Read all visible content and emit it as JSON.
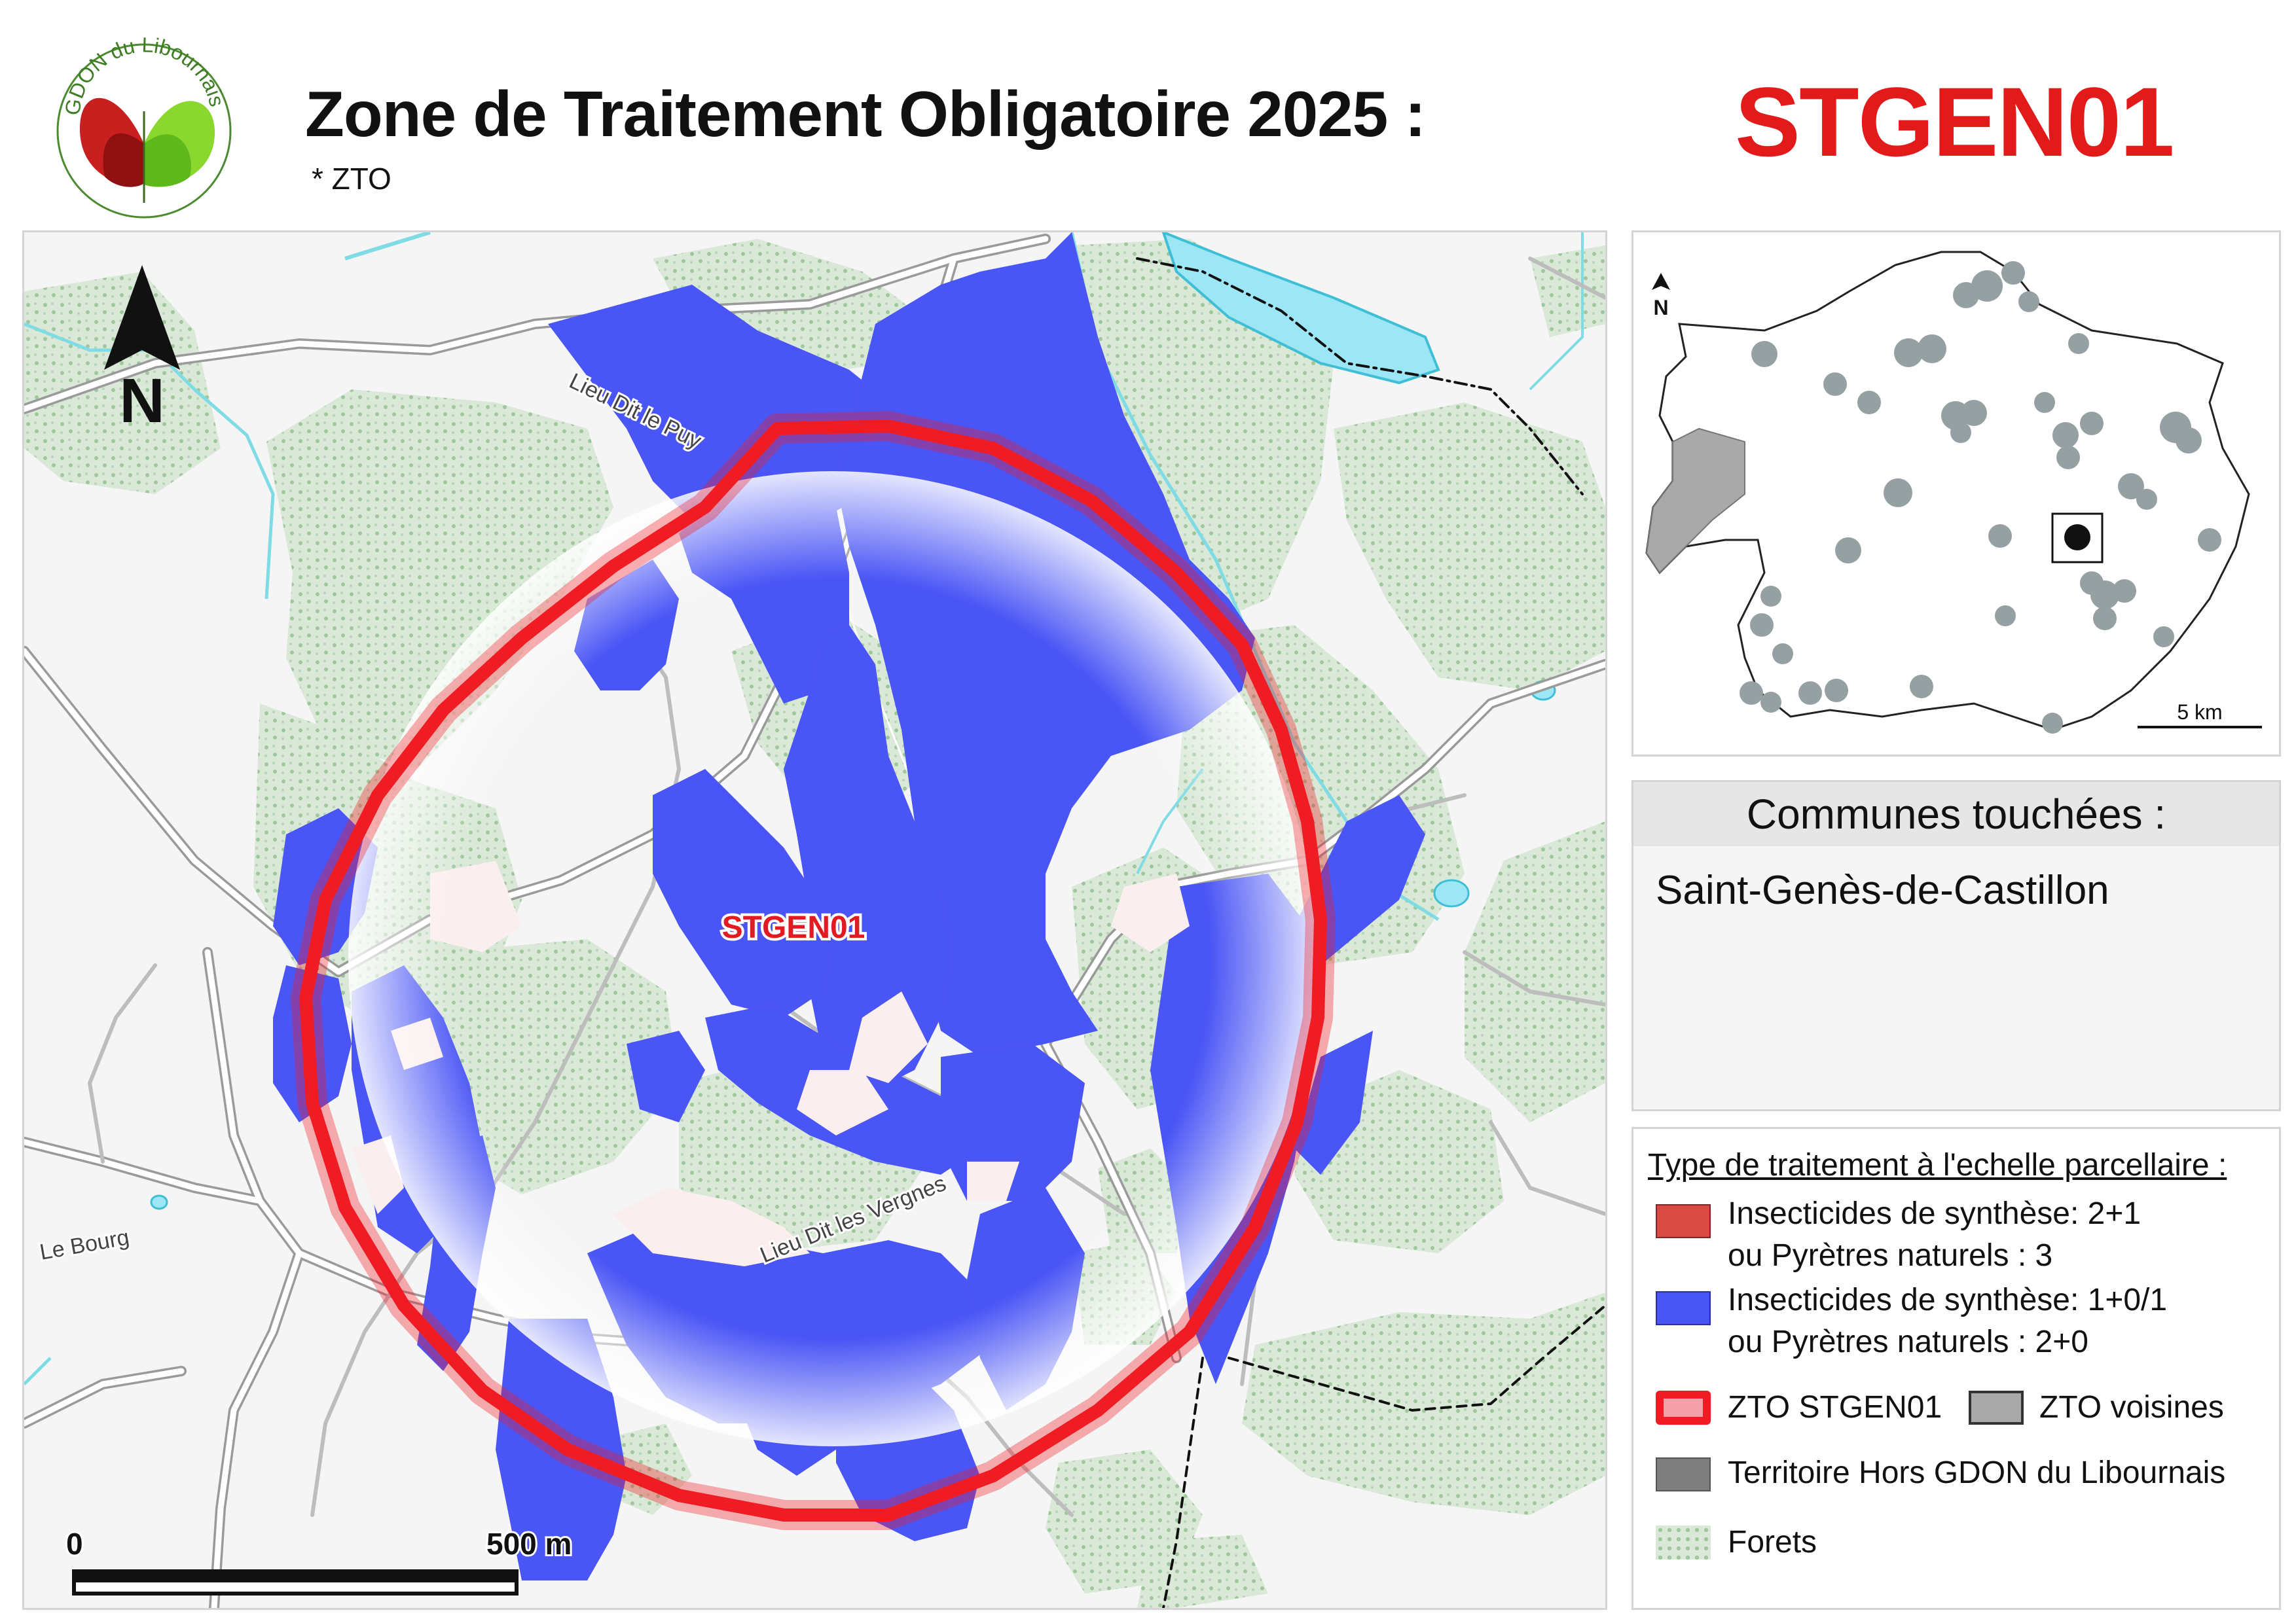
{
  "header": {
    "title": "Zone de Traitement Obligatoire 2025 :",
    "subtitle": "* ZTO",
    "zone_code": "STGEN01",
    "logo_text": "GDON du Libournais"
  },
  "main_map": {
    "zone_label": "STGEN01",
    "places": {
      "lieu_dit_puy": "Lieu Dit le Puy",
      "lieu_dit_vergnes": "Lieu Dit les Vergnes",
      "le_bourg": "Le Bourg"
    },
    "north_letter": "N",
    "scale": {
      "start": "0",
      "end": "500 m"
    }
  },
  "inset_map": {
    "north_letter": "N",
    "scale_label": "5 km"
  },
  "communes": {
    "heading": "Communes touchées :",
    "items": [
      "Saint-Genès-de-Castillon"
    ]
  },
  "legend": {
    "title": "Type de traitement à l'echelle parcellaire :",
    "red_line1": "Insecticides de synthèse: 2+1",
    "red_line2": "ou Pyrètres naturels : 3",
    "blue_line1": "Insecticides de synthèse: 1+0/1",
    "blue_line2": "ou Pyrètres naturels : 2+0",
    "zto_self": "ZTO STGEN01",
    "zto_neighbors": "ZTO voisines",
    "outside": "Territoire Hors GDON du Libournais",
    "forest": "Forets"
  },
  "colors": {
    "treatment_red": "#d94a44",
    "treatment_blue": "#4a55f5",
    "zone_outline": "#f01c24",
    "forest": "#d9e8d7",
    "water": "#9de6f5",
    "neighbor_zto": "#a9a9a9",
    "outside": "#7f7f7f"
  }
}
